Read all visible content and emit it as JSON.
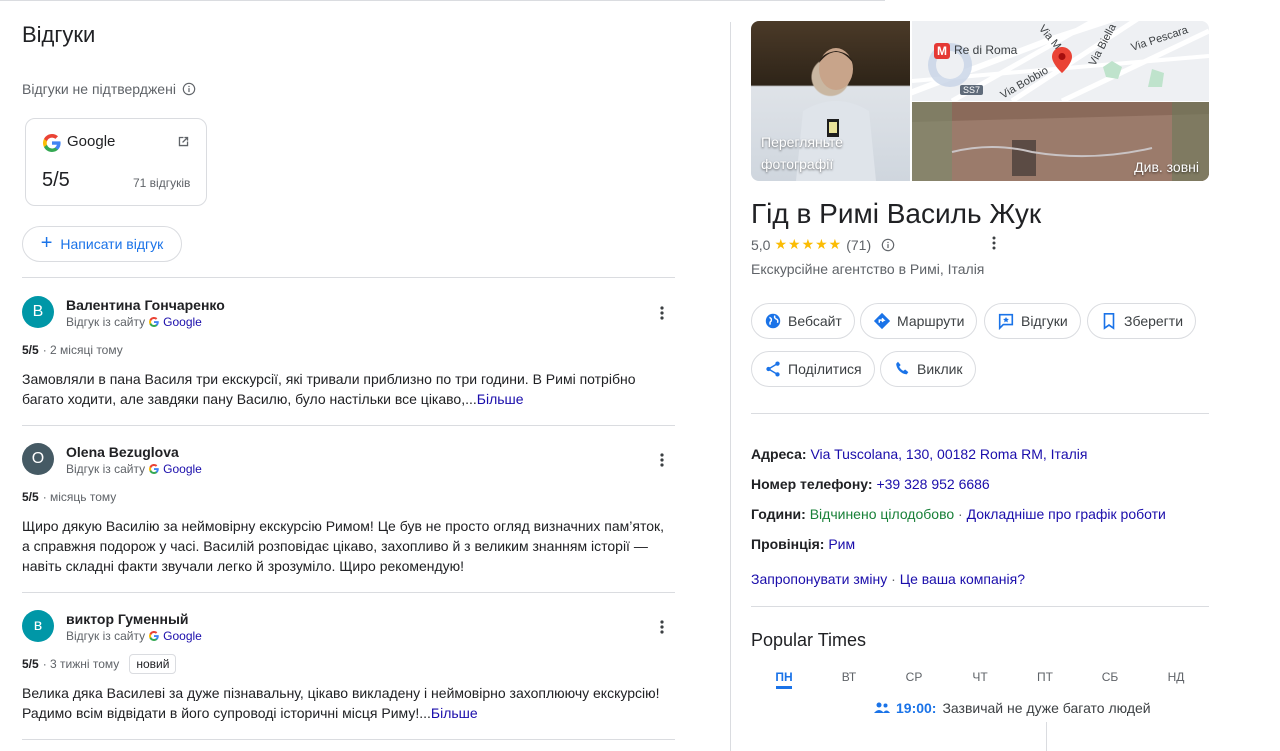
{
  "reviews_section": {
    "title": "Відгуки",
    "unverified_label": "Відгуки не підтверджені",
    "google_card": {
      "name": "Google",
      "score": "5/5",
      "count": "71 відгуків"
    },
    "write_button": "Написати відгук",
    "items": [
      {
        "avatar_letter": "В",
        "avatar_color": "#0097a7",
        "name": "Валентина Гончаренко",
        "source_prefix": "Відгук із сайту",
        "source": "Google",
        "score": "5/5",
        "time": "· 2 місяці тому",
        "badge": "",
        "text": "Замовляли в пана Василя три екскурсії, які тривали приблизно по три години. В Римі потрібно багато ходити, але завдяки пану Василю, було настільки все цікаво,...",
        "more": "Більше"
      },
      {
        "avatar_letter": "O",
        "avatar_color": "#455a64",
        "name": "Olena Bezuglova",
        "source_prefix": "Відгук із сайту",
        "source": "Google",
        "score": "5/5",
        "time": "· місяць тому",
        "badge": "",
        "text": "Щиро дякую Василію за неймовірну екскурсію Римом! Це був не просто огляд визначних пам’яток, а справжня подорож у часі. Василій розповідає цікаво, захопливо й з великим знанням історії — навіть складні факти звучали легко й зрозуміло. Щиро рекомендую!",
        "more": ""
      },
      {
        "avatar_letter": "в",
        "avatar_color": "#0097a7",
        "name": "виктор Гуменный",
        "source_prefix": "Відгук із сайту",
        "source": "Google",
        "score": "5/5",
        "time": "· 3 тижні тому",
        "badge": "новий",
        "text": "Велика дяка Василеві за дуже пізнавальну, цікаво викладену і неймовірно захоплюючу екскурсію! Радимо всім відвідати в його супроводі історичні місця Риму!...",
        "more": "Більше"
      }
    ]
  },
  "business": {
    "photos_caption": "Перегляньте фотографії",
    "outside_caption": "Див. зовні",
    "map_labels": {
      "station": "Re di Roma",
      "road": "SS7",
      "street1": "Via Bobbio",
      "street2": "Via Biella",
      "street3": "Via Pescara",
      "street4": "Via Mat"
    },
    "title": "Гід в Римі Василь Жук",
    "rating": "5,0",
    "stars": "★★★★★",
    "reviews_count": "(71)",
    "category": "Екскурсійне агентство в Римі, Італія",
    "actions": {
      "website": "Вебсайт",
      "directions": "Маршрути",
      "reviews": "Відгуки",
      "save": "Зберегти",
      "share": "Поділитися",
      "call": "Виклик"
    },
    "address_label": "Адреса:",
    "address_value": "Via Tuscolana, 130, 00182 Roma RM, Італія",
    "phone_label": "Номер телефону:",
    "phone_value": "+39 328 952 6686",
    "hours_label": "Години:",
    "hours_value": "Відчинено цілодобово",
    "hours_link": "Докладніше про графік роботи",
    "province_label": "Провінція:",
    "province_value": "Рим",
    "suggest_edit": "Запропонувати зміну",
    "own_business": "Це ваша компанія?",
    "popular_title": "Popular Times",
    "days": [
      "ПН",
      "ВТ",
      "СР",
      "ЧТ",
      "ПТ",
      "СБ",
      "НД"
    ],
    "live_time": "19:00:",
    "live_text": "Зазвичай не дуже багато людей"
  }
}
